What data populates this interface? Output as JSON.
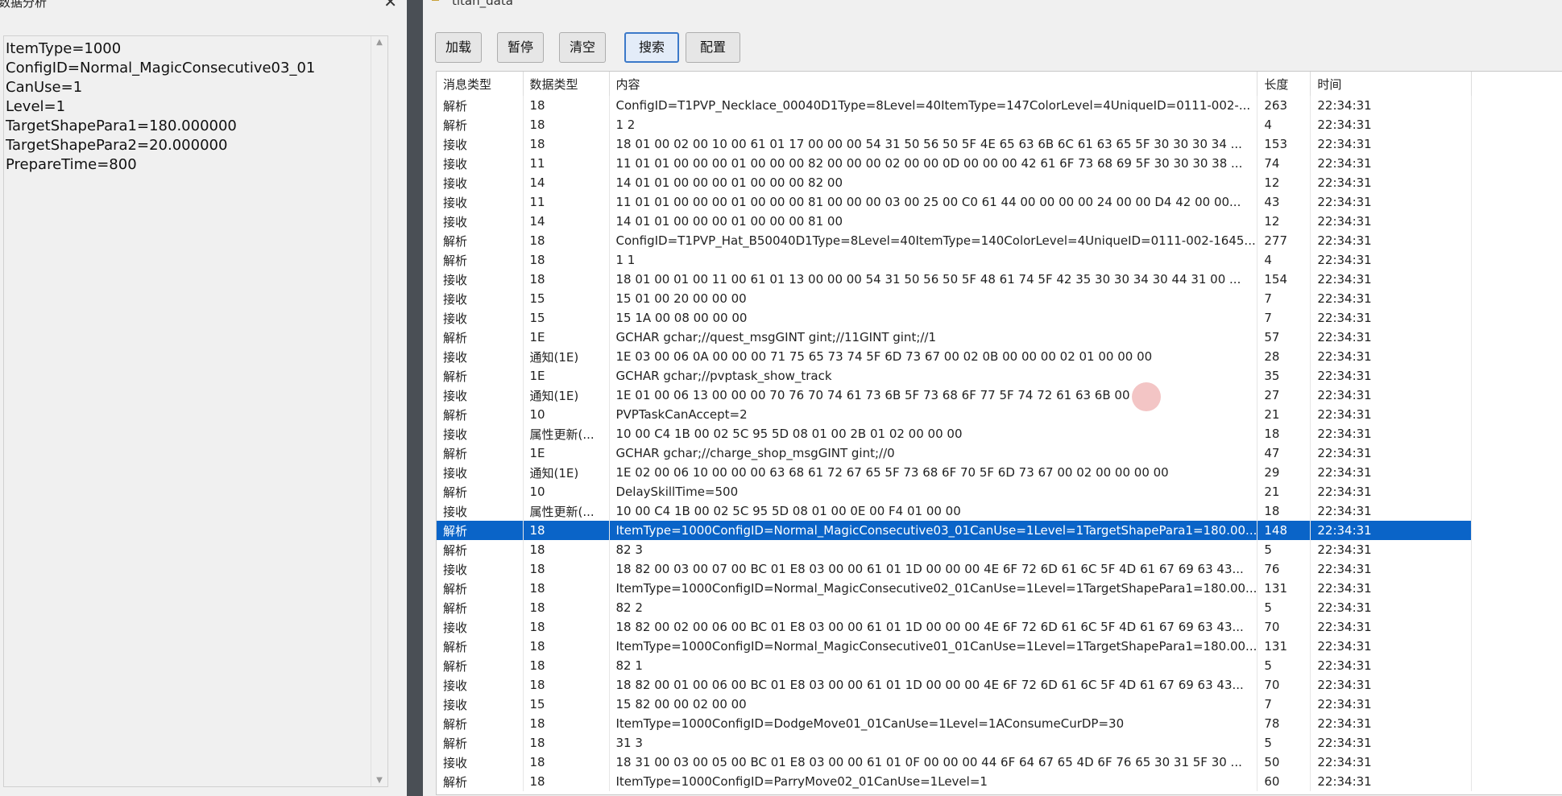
{
  "left_window": {
    "title": "数据分析",
    "close_glyph": "✕",
    "lines": [
      "ItemType=1000",
      "ConfigID=Normal_MagicConsecutive03_01",
      "CanUse=1",
      "Level=1",
      "TargetShapePara1=180.000000",
      "TargetShapePara2=20.000000",
      "PrepareTime=800"
    ]
  },
  "right_window": {
    "title": "titan_data",
    "toolbar": {
      "load_label": "加载",
      "pause_label": "暂停",
      "clear_label": "清空",
      "search_label": "搜索",
      "config_label": "配置"
    },
    "columns": [
      "消息类型",
      "数据类型",
      "内容",
      "长度",
      "时间"
    ],
    "selected_row_index": 22,
    "rows": [
      [
        "解析",
        "18",
        "ConfigID=T1PVP_Necklace_00040D1Type=8Level=40ItemType=147ColorLevel=4UniqueID=0111-002-...",
        "263",
        "22:34:31"
      ],
      [
        "解析",
        "18",
        "1 2",
        "4",
        "22:34:31"
      ],
      [
        "接收",
        "18",
        "18 01 00 02 00 10 00 61 01 17 00 00 00 54 31 50 56 50 5F 4E 65 63 6B 6C 61 63 65 5F 30 30 30 34 ...",
        "153",
        "22:34:31"
      ],
      [
        "接收",
        "11",
        "11 01 01 00 00 00 01 00 00 00 82 00 00 00 02 00 00 0D 00 00 00 42 61 6F 73 68 69 5F 30 30 30 38 ...",
        "74",
        "22:34:31"
      ],
      [
        "接收",
        "14",
        "14 01 01 00 00 00 01 00 00 00 82 00",
        "12",
        "22:34:31"
      ],
      [
        "接收",
        "11",
        "11 01 01 00 00 00 01 00 00 00 81 00 00 00 03 00 25 00 C0 61 44 00 00 00 00 24 00 00 D4 42 00 00...",
        "43",
        "22:34:31"
      ],
      [
        "接收",
        "14",
        "14 01 01 00 00 00 01 00 00 00 81 00",
        "12",
        "22:34:31"
      ],
      [
        "解析",
        "18",
        "ConfigID=T1PVP_Hat_B50040D1Type=8Level=40ItemType=140ColorLevel=4UniqueID=0111-002-1645...",
        "277",
        "22:34:31"
      ],
      [
        "解析",
        "18",
        "1 1",
        "4",
        "22:34:31"
      ],
      [
        "接收",
        "18",
        "18 01 00 01 00 11 00 61 01 13 00 00 00 54 31 50 56 50 5F 48 61 74 5F 42 35 30 30 34 30 44 31 00 ...",
        "154",
        "22:34:31"
      ],
      [
        "接收",
        "15",
        "15 01 00 20 00 00 00",
        "7",
        "22:34:31"
      ],
      [
        "接收",
        "15",
        "15 1A 00 08 00 00 00",
        "7",
        "22:34:31"
      ],
      [
        "解析",
        "1E",
        "GCHAR gchar;//quest_msgGINT gint;//11GINT gint;//1",
        "57",
        "22:34:31"
      ],
      [
        "接收",
        "通知(1E)",
        "1E 03 00 06 0A 00 00 00 71 75 65 73 74 5F 6D 73 67 00 02 0B 00 00 00 02 01 00 00 00",
        "28",
        "22:34:31"
      ],
      [
        "解析",
        "1E",
        "GCHAR gchar;//pvptask_show_track",
        "35",
        "22:34:31"
      ],
      [
        "接收",
        "通知(1E)",
        "1E 01 00 06 13 00 00 00 70 76 70 74 61 73 6B 5F 73 68 6F 77 5F 74 72 61 63 6B 00",
        "27",
        "22:34:31"
      ],
      [
        "解析",
        "10",
        "PVPTaskCanAccept=2",
        "21",
        "22:34:31"
      ],
      [
        "接收",
        "属性更新(...",
        "10 00 C4 1B 00 02 5C 95 5D 08 01 00 2B 01 02 00 00 00",
        "18",
        "22:34:31"
      ],
      [
        "解析",
        "1E",
        "GCHAR gchar;//charge_shop_msgGINT gint;//0",
        "47",
        "22:34:31"
      ],
      [
        "接收",
        "通知(1E)",
        "1E 02 00 06 10 00 00 00 63 68 61 72 67 65 5F 73 68 6F 70 5F 6D 73 67 00 02 00 00 00 00",
        "29",
        "22:34:31"
      ],
      [
        "解析",
        "10",
        "DelaySkillTime=500",
        "21",
        "22:34:31"
      ],
      [
        "接收",
        "属性更新(...",
        "10 00 C4 1B 00 02 5C 95 5D 08 01 00 0E 00 F4 01 00 00",
        "18",
        "22:34:31"
      ],
      [
        "解析",
        "18",
        "ItemType=1000ConfigID=Normal_MagicConsecutive03_01CanUse=1Level=1TargetShapePara1=180.00...",
        "148",
        "22:34:31"
      ],
      [
        "解析",
        "18",
        "82 3",
        "5",
        "22:34:31"
      ],
      [
        "接收",
        "18",
        "18 82 00 03 00 07 00 BC 01 E8 03 00 00 61 01 1D 00 00 00 4E 6F 72 6D 61 6C 5F 4D 61 67 69 63 43...",
        "76",
        "22:34:31"
      ],
      [
        "解析",
        "18",
        "ItemType=1000ConfigID=Normal_MagicConsecutive02_01CanUse=1Level=1TargetShapePara1=180.00...",
        "131",
        "22:34:31"
      ],
      [
        "解析",
        "18",
        "82 2",
        "5",
        "22:34:31"
      ],
      [
        "接收",
        "18",
        "18 82 00 02 00 06 00 BC 01 E8 03 00 00 61 01 1D 00 00 00 4E 6F 72 6D 61 6C 5F 4D 61 67 69 63 43...",
        "70",
        "22:34:31"
      ],
      [
        "解析",
        "18",
        "ItemType=1000ConfigID=Normal_MagicConsecutive01_01CanUse=1Level=1TargetShapePara1=180.00...",
        "131",
        "22:34:31"
      ],
      [
        "解析",
        "18",
        "82 1",
        "5",
        "22:34:31"
      ],
      [
        "接收",
        "18",
        "18 82 00 01 00 06 00 BC 01 E8 03 00 00 61 01 1D 00 00 00 4E 6F 72 6D 61 6C 5F 4D 61 67 69 63 43...",
        "70",
        "22:34:31"
      ],
      [
        "接收",
        "15",
        "15 82 00 00 02 00 00",
        "7",
        "22:34:31"
      ],
      [
        "解析",
        "18",
        "ItemType=1000ConfigID=DodgeMove01_01CanUse=1Level=1AConsumeCurDP=30",
        "78",
        "22:34:31"
      ],
      [
        "解析",
        "18",
        "31 3",
        "5",
        "22:34:31"
      ],
      [
        "接收",
        "18",
        "18 31 00 03 00 05 00 BC 01 E8 03 00 00 61 01 0F 00 00 00 44 6F 64 67 65 4D 6F 76 65 30 31 5F 30 ...",
        "50",
        "22:34:31"
      ],
      [
        "解析",
        "18",
        "ItemType=1000ConfigID=ParryMove02_01CanUse=1Level=1",
        "60",
        "22:34:31"
      ]
    ]
  }
}
